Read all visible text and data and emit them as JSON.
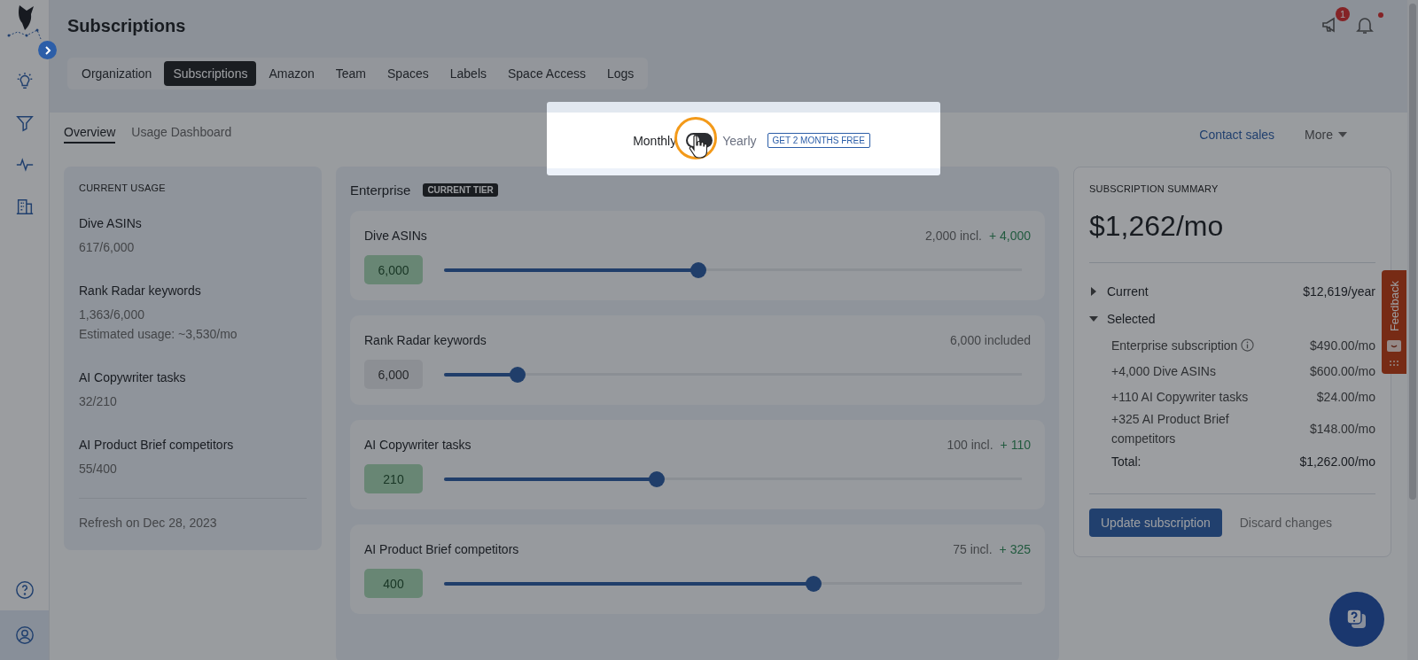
{
  "sidebar": {
    "items": [
      {
        "kind": "bulb",
        "selected": false
      },
      {
        "kind": "filter",
        "selected": false
      },
      {
        "kind": "pulse",
        "selected": false
      },
      {
        "kind": "building",
        "selected": false
      }
    ],
    "bottom_items": [
      {
        "kind": "help",
        "selected": false
      },
      {
        "kind": "user",
        "selected": true
      }
    ]
  },
  "header": {
    "title": "Subscriptions",
    "announcement_badge": "1",
    "bell_unread": true
  },
  "tabs": [
    {
      "label": "Organization",
      "selected": false
    },
    {
      "label": "Subscriptions",
      "selected": true
    },
    {
      "label": "Amazon",
      "selected": false
    },
    {
      "label": "Team",
      "selected": false
    },
    {
      "label": "Spaces",
      "selected": false
    },
    {
      "label": "Labels",
      "selected": false
    },
    {
      "label": "Space Access",
      "selected": false
    },
    {
      "label": "Logs",
      "selected": false
    }
  ],
  "subtabs": [
    {
      "label": "Overview",
      "selected": true
    },
    {
      "label": "Usage Dashboard",
      "selected": false
    }
  ],
  "actions": {
    "contact_sales": "Contact sales",
    "more": "More"
  },
  "billing_toggle": {
    "monthly_label": "Monthly",
    "yearly_label": "Yearly",
    "on": false,
    "promo": "GET 2 MONTHS FREE"
  },
  "current_usage": {
    "title": "CURRENT USAGE",
    "items": [
      {
        "name": "Dive ASINs",
        "usage": "617/6,000"
      },
      {
        "name": "Rank Radar keywords",
        "usage": "1,363/6,000",
        "estimate": "Estimated usage: ~3,530/mo"
      },
      {
        "name": "AI Copywriter tasks",
        "usage": "32/210"
      },
      {
        "name": "AI Product Brief competitors",
        "usage": "55/400"
      }
    ],
    "refresh": "Refresh on Dec 28, 2023"
  },
  "plan": {
    "name": "Enterprise",
    "badge": "CURRENT TIER",
    "sliders": [
      {
        "name": "Dive ASINs",
        "included": "2,000 incl.",
        "added": "+ 4,000",
        "value": "6,000",
        "changed": true,
        "level": 0.44
      },
      {
        "name": "Rank Radar keywords",
        "included": "6,000 included",
        "value": "6,000",
        "changed": false,
        "level": 0.127
      },
      {
        "name": "AI Copywriter tasks",
        "included": "100 incl.",
        "added": "+ 110",
        "value": "210",
        "changed": true,
        "level": 0.368
      },
      {
        "name": "AI Product Brief competitors",
        "included": "75 incl.",
        "added": "+ 325",
        "value": "400",
        "changed": true,
        "level": 0.64
      }
    ]
  },
  "summary": {
    "title": "SUBSCRIPTION SUMMARY",
    "price": "$1,262/mo",
    "groups": [
      {
        "label": "Current",
        "amount": "$12,619/year",
        "expanded": false
      },
      {
        "label": "Selected",
        "expanded": true,
        "lines": [
          {
            "label": "Enterprise subscription",
            "amount": "$490.00/mo",
            "info": true
          },
          {
            "label": "+4,000 Dive ASINs",
            "amount": "$600.00/mo",
            "info": false
          },
          {
            "label": "+110 AI Copywriter tasks",
            "amount": "$24.00/mo",
            "info": false
          },
          {
            "label": "+325 AI Product Brief competitors",
            "amount": "$148.00/mo",
            "info": false
          }
        ],
        "total_label": "Total:",
        "total_amount": "$1,262.00/mo"
      }
    ],
    "primary_button": "Update subscription",
    "secondary_button": "Discard changes"
  },
  "feedback_tab": {
    "label": "Feedback"
  }
}
